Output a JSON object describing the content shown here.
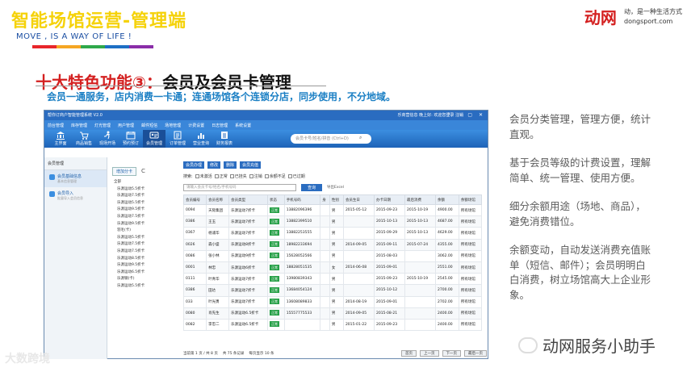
{
  "header": {
    "title": "智能场馆运营-管理端",
    "subtitle": "MOVE , IS A WAY OF LIFE !",
    "strip_colors": [
      "#e8262a",
      "#f5a623",
      "#2ea84a",
      "#1d6fc4",
      "#8a2da8"
    ],
    "brand": "动网",
    "slogan_line1": "动，是一种生活方式",
    "slogan_line2": "dongsport.com"
  },
  "feature": {
    "num": "十大特色功能③：",
    "title": "会员及会员卡管理",
    "desc": "会员一通服务，店内消费一卡通；连通场馆各个连锁分店，同步使用，不分地域。"
  },
  "app": {
    "window_title": "帮你订商户智能管理系统 V2.0",
    "window_info": "乐商营信息 晚上好: 欢迎您登录  注销",
    "window_controls": "? — ▢ ✕",
    "menu": [
      "前台管理",
      "库存管理",
      "灯光管理",
      "用户管理",
      "邮件短信",
      "场地管理",
      "计费设置",
      "日志管理",
      "系统设置"
    ],
    "toolbar": [
      {
        "label": "主界面",
        "icon": "bank-icon"
      },
      {
        "label": "商品销售",
        "icon": "cart-icon"
      },
      {
        "label": "现场开场",
        "icon": "run-icon"
      },
      {
        "label": "预约预订",
        "icon": "calendar-icon"
      },
      {
        "label": "会员管理",
        "icon": "member-icon"
      },
      {
        "label": "订单管理",
        "icon": "order-icon"
      },
      {
        "label": "营业查询",
        "icon": "chart-icon"
      },
      {
        "label": "财务报表",
        "icon": "report-icon"
      }
    ],
    "toolbar_search": "会员卡号/姓名/拼音 (Ctrl+D)",
    "left_pane": {
      "heading": "会员管理",
      "items": [
        {
          "title": "会员基础信息",
          "sub": "基本信息管理"
        },
        {
          "title": "会员导入",
          "sub": "批量导入会员信息"
        }
      ]
    },
    "mid_pane": {
      "button": "增加分卡",
      "refresh": "C",
      "cards": [
        "全部",
        "乐源运动5.5折卡",
        "乐源运动7.5折卡",
        "乐源运动5.5折卡",
        "乐源运动9.5折卡",
        "乐源运动7.5折卡",
        "乐源运动9.5折卡",
        "羽毛(卡)",
        "乐源运动5.5折卡",
        "乐源运动7.5折卡",
        "乐源运动7.5折卡",
        "乐源运动8.5折卡",
        "乐源运动9.5折卡",
        "乐源运动6.5折卡",
        "乐源钢(卡)",
        "乐源运动5.5折卡"
      ]
    },
    "actions": [
      "会员办理",
      "修改",
      "删除",
      "会员充值"
    ],
    "filters": {
      "label": "搜索:",
      "opts": [
        "未激活",
        "正常",
        "已挂失",
        "注销",
        "余额不足",
        "已过期"
      ]
    },
    "search": {
      "placeholder": "请输入会员卡号/姓名/手机号码",
      "button": "查询",
      "excel": "导出Excel"
    },
    "columns": [
      "会员编号",
      "会员名称",
      "会员类型",
      "状态",
      "手机号码",
      "身",
      "性别",
      "会员生日",
      "办卡日期",
      "最后消费",
      "余额",
      "余额场馆"
    ],
    "rows": [
      [
        "0094",
        "天际集团",
        "乐源运动7折卡",
        "正常",
        "13882096396",
        "",
        "男",
        "2015-05-12",
        "2015-09-23",
        "2015-10-19",
        "4900.00",
        "所有场馆"
      ],
      [
        "0386",
        "王玉",
        "乐源运动7折卡",
        "正常",
        "13882399510",
        "",
        "男",
        "",
        "2015-10-13",
        "2015-10-13",
        "4687.00",
        "所有场馆"
      ],
      [
        "0367",
        "杨浦华",
        "乐源运动7折卡",
        "正常",
        "13882253555",
        "",
        "男",
        "",
        "2015-09-29",
        "2015-10-13",
        "4629.00",
        "所有场馆"
      ],
      [
        "0026",
        "森小盛",
        "乐源运动8折卡",
        "正常",
        "18982233694",
        "",
        "男",
        "2014-09-05",
        "2015-09-11",
        "2015-07-24",
        "4355.00",
        "所有场馆"
      ],
      [
        "0086",
        "张小林",
        "乐源运动9折卡",
        "正常",
        "15628052566",
        "",
        "男",
        "",
        "2015-08-03",
        "",
        "3062.00",
        "所有场馆"
      ],
      [
        "0001",
        "林忠",
        "乐源运动6折卡",
        "正常",
        "18828051535",
        "",
        "女",
        "2014-06-08",
        "2015-09-01",
        "",
        "2551.00",
        "所有场馆"
      ],
      [
        "0111",
        "叶青华",
        "乐源运动7折卡",
        "正常",
        "13980839343",
        "",
        "男",
        "",
        "2015-09-23",
        "2015-10-19",
        "2545.00",
        "所有场馆"
      ],
      [
        "0386",
        "田达",
        "乐源运动7折卡",
        "正常",
        "13684054124",
        "",
        "男",
        "",
        "2015-10-12",
        "",
        "2700.00",
        "所有场馆"
      ],
      [
        "033",
        "叶光勇",
        "乐源运动7折卡",
        "正常",
        "13608089833",
        "",
        "男",
        "2014-08-19",
        "2015-09-01",
        "",
        "2702.00",
        "所有场馆"
      ],
      [
        "0080",
        "肖先生",
        "乐源运动6.5折卡",
        "正常",
        "15557775533",
        "",
        "男",
        "2014-09-05",
        "2015-08-21",
        "",
        "2400.00",
        "所有场馆"
      ],
      [
        "0082",
        "李忠二",
        "乐源运动6.5折卡",
        "正常",
        "",
        "",
        "男",
        "2015-01-22",
        "2015-09-23",
        "",
        "2400.00",
        "所有场馆"
      ]
    ],
    "pager": {
      "current": "当前第 1 页 / 共 8 页",
      "total": "共 75 条记录",
      "page_size": "每页显示 10 条",
      "buttons": [
        "首页",
        "上一页",
        "下一页",
        "最后一页"
      ]
    }
  },
  "features": [
    "会员分类管理，管理方便，统计直观。",
    "基于会员等级的计费设置，理解简单、统一管理、使用方便。",
    "细分余额用途（场地、商品），避免消费错位。",
    "余额变动，自动发送消费充值账单（短信、邮件）；会员明明白白消费，树立场馆高大上企业形象。"
  ],
  "watermarks": {
    "left": "大数跨境",
    "right": "动网服务小助手"
  }
}
